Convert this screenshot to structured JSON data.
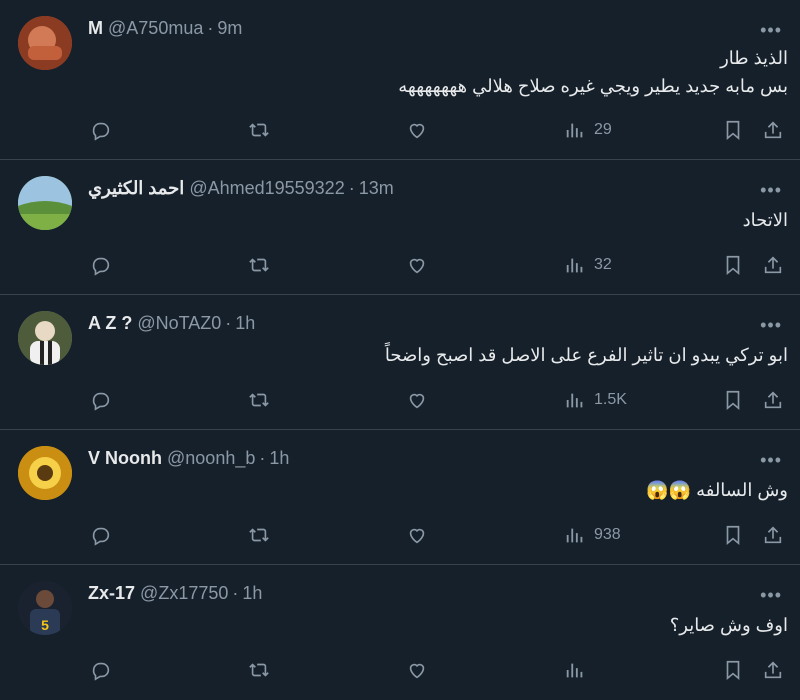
{
  "tweets": [
    {
      "name": "M",
      "handle": "@A750mua",
      "time": "9m",
      "lines": [
        "الذيذ طار",
        "بس مابه جديد يطير ويجي غيره  صلاح هلالي هههههههه"
      ],
      "views": "29",
      "avatar_color": "#b5563a"
    },
    {
      "name": "احمد الكثيري",
      "handle": "@Ahmed19559322",
      "time": "13m",
      "lines": [
        "الاتحاد"
      ],
      "views": "32",
      "avatar_color": "#6aa84f"
    },
    {
      "name": "A Z ?",
      "handle": "@NoTAZ0",
      "time": "1h",
      "lines": [
        "ابو تركي يبدو ان تاثير الفرع على الاصل قد اصبح واضحاً"
      ],
      "views": "1.5K",
      "avatar_color": "#7b8a6a"
    },
    {
      "name": "V Noonh",
      "handle": "@noonh_b",
      "time": "1h",
      "lines": [
        "وش السالفه"
      ],
      "emoji": "😱😱",
      "views": "938",
      "avatar_color": "#d4a017"
    },
    {
      "name": "Zx-17",
      "handle": "@Zx17750",
      "time": "1h",
      "lines": [
        "اوف وش صاير؟"
      ],
      "views": "",
      "avatar_color": "#1f2a38"
    }
  ],
  "icons": {
    "more": "more-icon",
    "reply": "reply-icon",
    "retweet": "retweet-icon",
    "like": "like-icon",
    "views": "views-icon",
    "bookmark": "bookmark-icon",
    "share": "share-icon"
  },
  "colors": {
    "background": "#15202b",
    "text": "#e7e9ea",
    "muted": "#8b98a5",
    "divider": "#38444d"
  }
}
